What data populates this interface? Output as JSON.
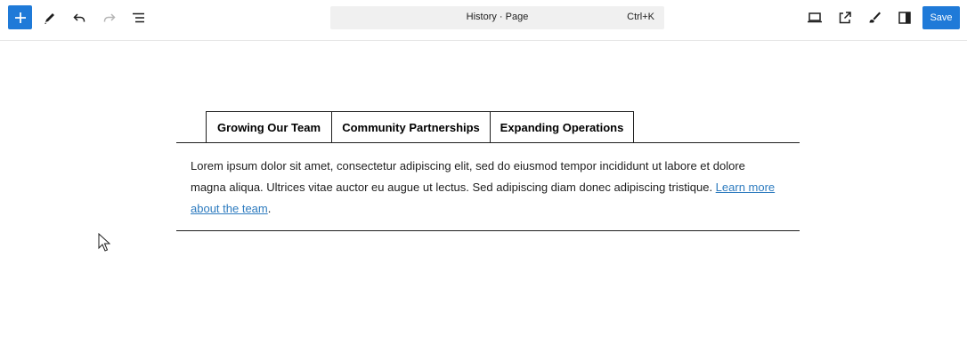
{
  "toolbar": {
    "add_icon": "plus-icon",
    "tools_icon": "pencil-icon",
    "undo_icon": "undo-icon",
    "redo_icon": "redo-icon",
    "outline_icon": "document-overview-icon",
    "view_icon": "desktop-view-icon",
    "preview_icon": "external-link-icon",
    "styles_icon": "brush-icon",
    "settings_icon": "sidebar-toggle-icon",
    "save_label": "Save",
    "accent": "#1f7ad8"
  },
  "command_bar": {
    "title": "History · Page",
    "shortcut": "Ctrl+K"
  },
  "tabs": {
    "items": [
      {
        "label": "Growing Our Team"
      },
      {
        "label": "Community Partnerships"
      },
      {
        "label": "Expanding Operations"
      }
    ]
  },
  "panel": {
    "text": "Lorem ipsum dolor sit amet, consectetur adipiscing elit, sed do eiusmod tempor incididunt ut labore et dolore magna aliqua. Ultrices vitae auctor eu augue ut lectus. Sed adipiscing diam donec adipiscing tristique. ",
    "link_text": "Learn more about the team",
    "trailing": ".",
    "link_color": "#2d7bbf"
  }
}
